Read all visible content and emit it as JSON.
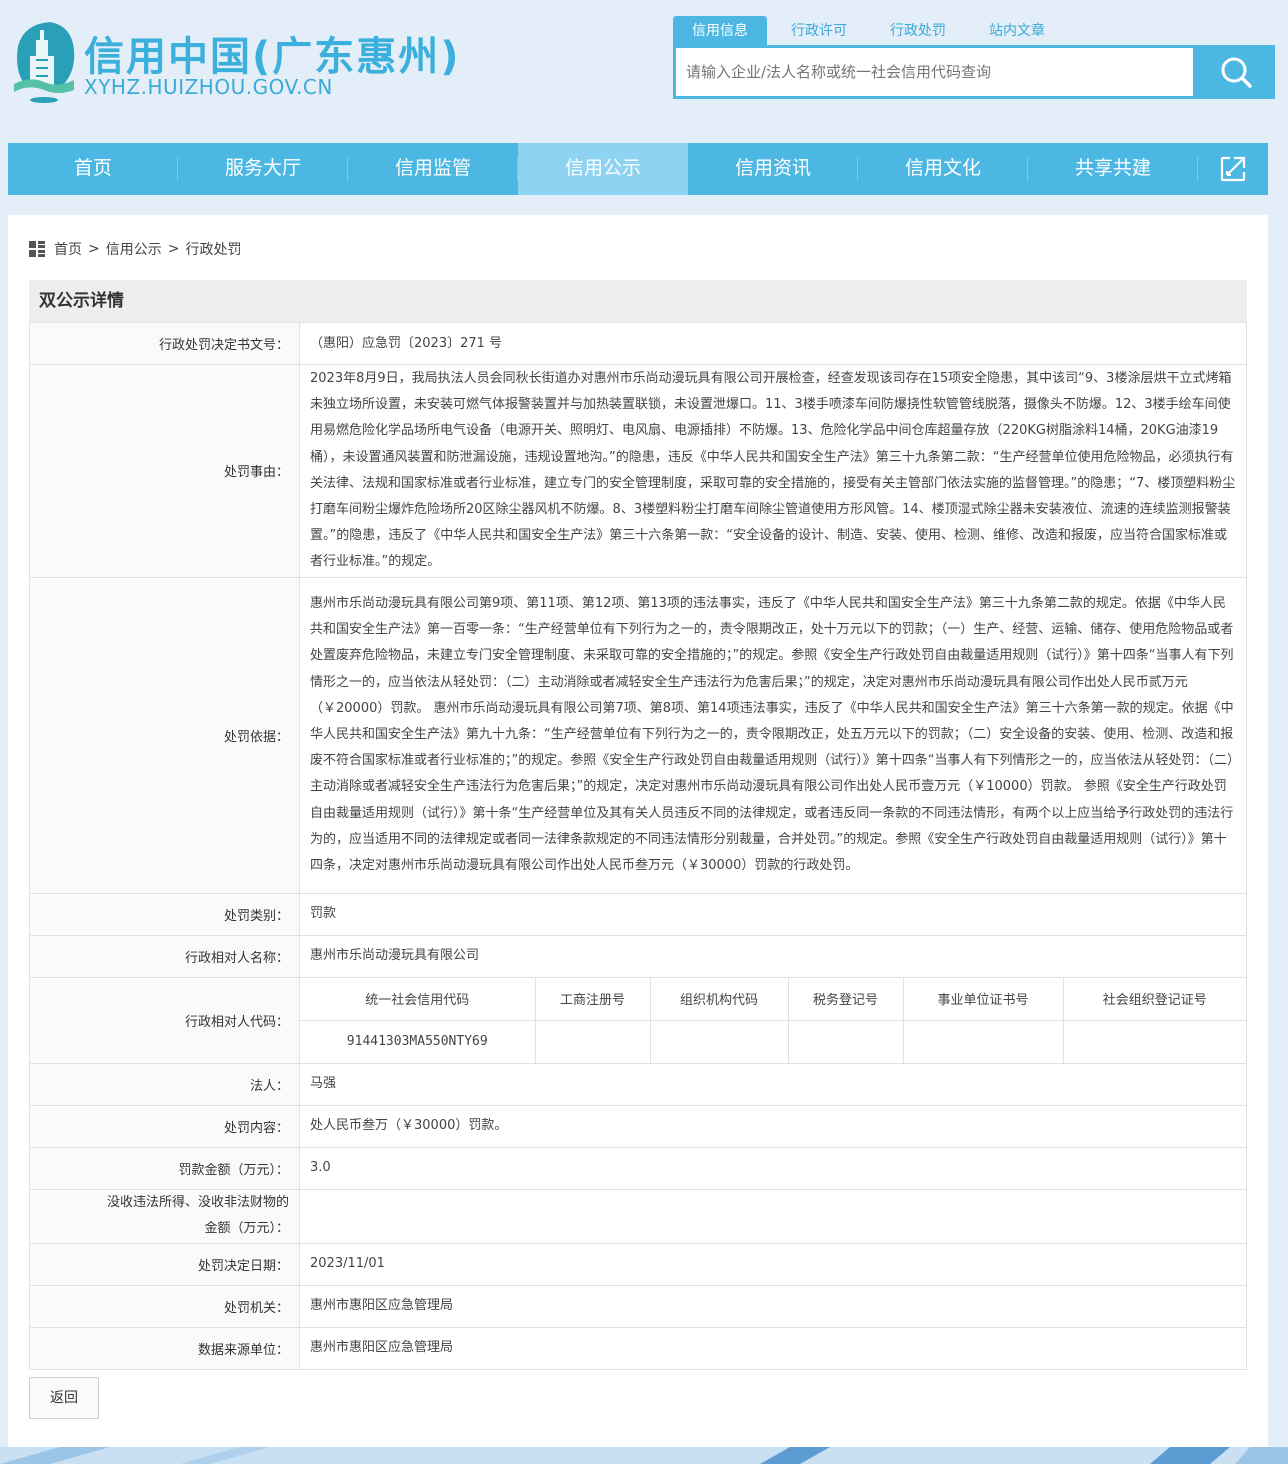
{
  "header": {
    "site_title": "信用中国(广东惠州)",
    "site_url": "XYHZ.HUIZHOU.GOV.CN",
    "logo_icon": "huizhou-tower-logo",
    "accent_color": "#4db7e3"
  },
  "search": {
    "tabs": [
      "信用信息",
      "行政许可",
      "行政处罚",
      "站内文章"
    ],
    "active_tab": "信用信息",
    "placeholder": "请输入企业/法人名称或统一社会信用代码查询",
    "button_icon": "search-icon"
  },
  "nav": {
    "items": [
      "首页",
      "服务大厅",
      "信用监管",
      "信用公示",
      "信用资讯",
      "信用文化",
      "共享共建"
    ],
    "active": "信用公示",
    "expand_icon": "expand-icon"
  },
  "breadcrumb": {
    "icon": "grid-icon",
    "items": [
      "首页",
      "信用公示",
      "行政处罚"
    ],
    "separator": ">"
  },
  "detail": {
    "title": "双公示详情",
    "rows": {
      "doc_no": {
        "label": "行政处罚决定书文号：",
        "value": "（惠阳）应急罚〔2023〕271 号"
      },
      "reason": {
        "label": "处罚事由：",
        "value": "2023年8月9日，我局执法人员会同秋长街道办对惠州市乐尚动漫玩具有限公司开展检查，经查发现该司存在15项安全隐患，其中该司“9、3楼涂层烘干立式烤箱未独立场所设置，未安装可燃气体报警装置并与加热装置联锁，未设置泄爆口。11、3楼手喷漆车间防爆挠性软管管线脱落，摄像头不防爆。12、3楼手绘车间使用易燃危险化学品场所电气设备（电源开关、照明灯、电风扇、电源插排）不防爆。13、危险化学品中间仓库超量存放（220KG树脂涂料14桶，20KG油漆19桶），未设置通风装置和防泄漏设施，违规设置地沟。”的隐患，违反《中华人民共和国安全生产法》第三十九条第二款：“生产经营单位使用危险物品，必须执行有关法律、法规和国家标准或者行业标准，建立专门的安全管理制度，采取可靠的安全措施的，接受有关主管部门依法实施的监督管理。”的隐患；“7、楼顶塑料粉尘打磨车间粉尘爆炸危险场所20区除尘器风机不防爆。8、3楼塑料粉尘打磨车间除尘管道使用方形风管。14、楼顶湿式除尘器未安装液位、流速的连续监测报警装置。”的隐患，违反了《中华人民共和国安全生产法》第三十六条第一款：“安全设备的设计、制造、安装、使用、检测、维修、改造和报废，应当符合国家标准或者行业标准。”的规定。"
      },
      "basis": {
        "label": "处罚依据：",
        "value": "惠州市乐尚动漫玩具有限公司第9项、第11项、第12项、第13项的违法事实，违反了《中华人民共和国安全生产法》第三十九条第二款的规定。依据《中华人民共和国安全生产法》第一百零一条：“生产经营单位有下列行为之一的，责令限期改正，处十万元以下的罚款；（一）生产、经营、运输、储存、使用危险物品或者处置废弃危险物品，未建立专门安全管理制度、未采取可靠的安全措施的；”的规定。参照《安全生产行政处罚自由裁量适用规则（试行）》第十四条“当事人有下列情形之一的，应当依法从轻处罚：（二）主动消除或者减轻安全生产违法行为危害后果；”的规定，决定对惠州市乐尚动漫玩具有限公司作出处人民币贰万元（￥20000）罚款。 惠州市乐尚动漫玩具有限公司第7项、第8项、第14项违法事实，违反了《中华人民共和国安全生产法》第三十六条第一款的规定。依据《中华人民共和国安全生产法》第九十九条：“生产经营单位有下列行为之一的，责令限期改正，处五万元以下的罚款；（二）安全设备的安装、使用、检测、改造和报废不符合国家标准或者行业标准的；”的规定。参照《安全生产行政处罚自由裁量适用规则（试行）》第十四条“当事人有下列情形之一的，应当依法从轻处罚：（二）主动消除或者减轻安全生产违法行为危害后果；”的规定，决定对惠州市乐尚动漫玩具有限公司作出处人民币壹万元（￥10000）罚款。 参照《安全生产行政处罚自由裁量适用规则（试行）》第十条“生产经营单位及其有关人员违反不同的法律规定，或者违反同一条款的不同违法情形，有两个以上应当给予行政处罚的违法行为的，应当适用不同的法律规定或者同一法律条款规定的不同违法情形分别裁量，合并处罚。”的规定。参照《安全生产行政处罚自由裁量适用规则（试行）》第十四条，决定对惠州市乐尚动漫玩具有限公司作出处人民币叁万元（￥30000）罚款的行政处罚。"
      },
      "category": {
        "label": "处罚类别：",
        "value": "罚款"
      },
      "party_name": {
        "label": "行政相对人名称：",
        "value": "惠州市乐尚动漫玩具有限公司"
      },
      "party_code": {
        "label": "行政相对人代码：",
        "headers": [
          "统一社会信用代码",
          "工商注册号",
          "组织机构代码",
          "税务登记号",
          "事业单位证书号",
          "社会组织登记证号"
        ],
        "values": [
          "91441303MA550NTY69",
          "",
          "",
          "",
          "",
          ""
        ]
      },
      "legal_person": {
        "label": "法人：",
        "value": "马强"
      },
      "content": {
        "label": "处罚内容：",
        "value": "处人民币叁万（￥30000）罚款。"
      },
      "amount": {
        "label": "罚款金额（万元）：",
        "value": "3.0"
      },
      "confiscation": {
        "label_line1": "没收违法所得、没收非法财物的",
        "label_line2": "金额（万元）：",
        "value": ""
      },
      "decision_date": {
        "label": "处罚决定日期：",
        "value": "2023/11/01"
      },
      "authority": {
        "label": "处罚机关：",
        "value": "惠州市惠阳区应急管理局"
      },
      "data_source": {
        "label": "数据来源单位：",
        "value": "惠州市惠阳区应急管理局"
      }
    }
  },
  "back_button": "返回"
}
